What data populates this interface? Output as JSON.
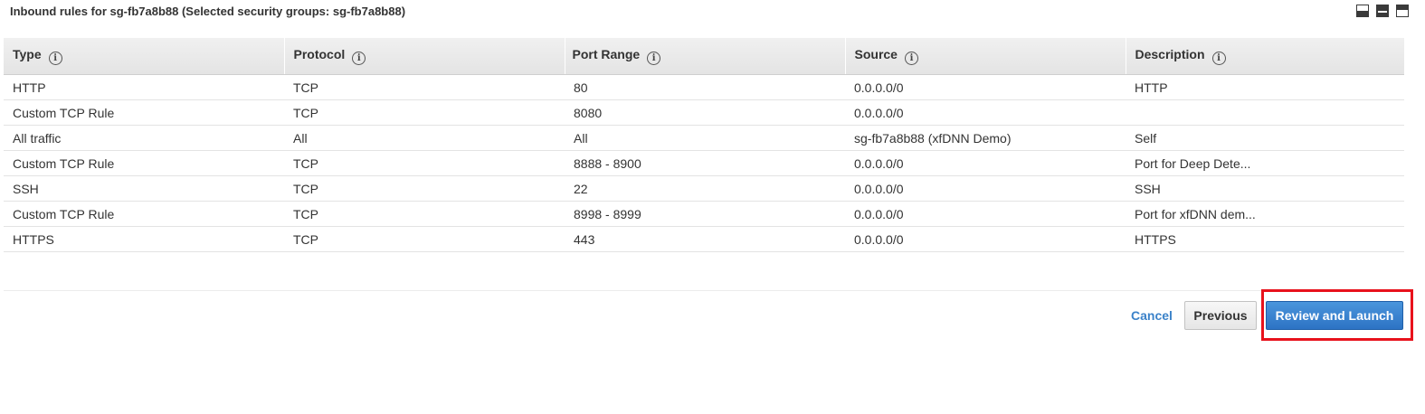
{
  "header": {
    "title": "Inbound rules for sg-fb7a8b88 (Selected security groups: sg-fb7a8b88)"
  },
  "table": {
    "columns": [
      "Type",
      "Protocol",
      "Port Range",
      "Source",
      "Description"
    ],
    "info_glyph": "i",
    "rows": [
      [
        "HTTP",
        "TCP",
        "80",
        "0.0.0.0/0",
        "HTTP"
      ],
      [
        "Custom TCP Rule",
        "TCP",
        "8080",
        "0.0.0.0/0",
        ""
      ],
      [
        "All traffic",
        "All",
        "All",
        "sg-fb7a8b88 (xfDNN Demo)",
        "Self"
      ],
      [
        "Custom TCP Rule",
        "TCP",
        "8888 - 8900",
        "0.0.0.0/0",
        "Port for Deep Dete..."
      ],
      [
        "SSH",
        "TCP",
        "22",
        "0.0.0.0/0",
        "SSH"
      ],
      [
        "Custom TCP Rule",
        "TCP",
        "8998 - 8999",
        "0.0.0.0/0",
        "Port for xfDNN dem..."
      ],
      [
        "HTTPS",
        "TCP",
        "443",
        "0.0.0.0/0",
        "HTTPS"
      ]
    ]
  },
  "footer": {
    "cancel_label": "Cancel",
    "previous_label": "Previous",
    "review_launch_label": "Review and Launch"
  },
  "icons": {
    "view_toggles": [
      "split-bottom-icon",
      "split-middle-icon",
      "split-top-icon"
    ],
    "info": "info-circle-icon"
  },
  "colors": {
    "primary_button": "#2d73c4",
    "link": "#3b82c9",
    "highlight": "#e8121c"
  }
}
